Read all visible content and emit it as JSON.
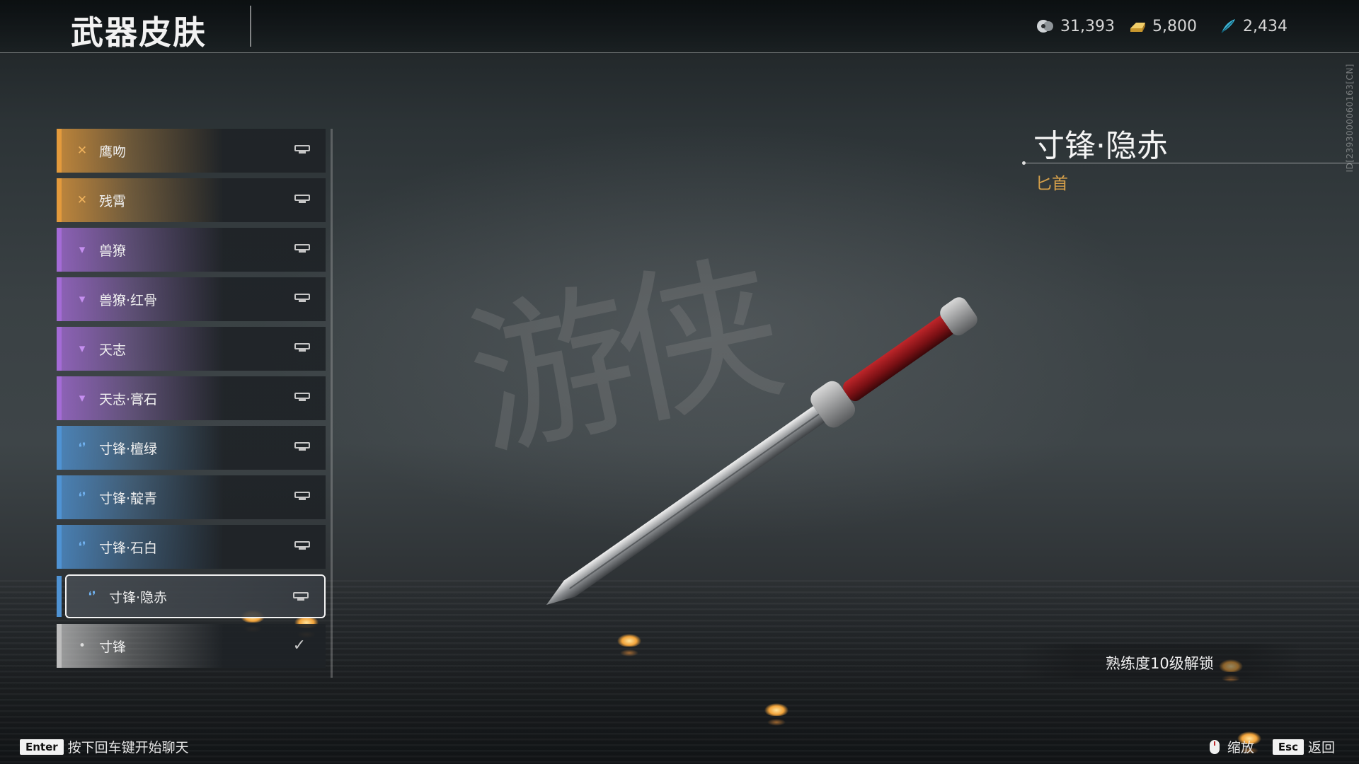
{
  "header": {
    "title": "武器皮肤",
    "currencies": [
      {
        "icon": "jade-coin-icon",
        "value": "31,393",
        "color": "#cfd3d6"
      },
      {
        "icon": "gold-ingot-icon",
        "value": "5,800",
        "color": "#e8c25a"
      },
      {
        "icon": "blue-feather-icon",
        "value": "2,434",
        "color": "#3fb6d6"
      }
    ],
    "build_id": "ID[2393000060163[CN]"
  },
  "skins": [
    {
      "label": "鹰吻",
      "rarity_color": "#e39a3c",
      "glyph": "✕",
      "glyph_color": "#f0b25c",
      "selected": false,
      "owned": false
    },
    {
      "label": "残霄",
      "rarity_color": "#e39a3c",
      "glyph": "✕",
      "glyph_color": "#f0b25c",
      "selected": false,
      "owned": false
    },
    {
      "label": "兽獠",
      "rarity_color": "#a46bd6",
      "glyph": "▾",
      "glyph_color": "#c58ef0",
      "selected": false,
      "owned": false
    },
    {
      "label": "兽獠·红骨",
      "rarity_color": "#a46bd6",
      "glyph": "▾",
      "glyph_color": "#c58ef0",
      "selected": false,
      "owned": false
    },
    {
      "label": "天志",
      "rarity_color": "#a46bd6",
      "glyph": "▾",
      "glyph_color": "#c58ef0",
      "selected": false,
      "owned": false
    },
    {
      "label": "天志·膏石",
      "rarity_color": "#a46bd6",
      "glyph": "▾",
      "glyph_color": "#c58ef0",
      "selected": false,
      "owned": false
    },
    {
      "label": "寸锋·檀绿",
      "rarity_color": "#4f93d4",
      "glyph": "❛❜",
      "glyph_color": "#6fb0ee",
      "selected": false,
      "owned": false
    },
    {
      "label": "寸锋·靛青",
      "rarity_color": "#4f93d4",
      "glyph": "❛❜",
      "glyph_color": "#6fb0ee",
      "selected": false,
      "owned": false
    },
    {
      "label": "寸锋·石白",
      "rarity_color": "#4f93d4",
      "glyph": "❛❜",
      "glyph_color": "#6fb0ee",
      "selected": false,
      "owned": false
    },
    {
      "label": "寸锋·隐赤",
      "rarity_color": "#4f93d4",
      "glyph": "❛❜",
      "glyph_color": "#6fb0ee",
      "selected": true,
      "owned": false
    },
    {
      "label": "寸锋",
      "rarity_color": "#bdbdbd",
      "glyph": "•",
      "glyph_color": "#dddddd",
      "selected": false,
      "owned": true
    }
  ],
  "detail": {
    "name": "寸锋·隐赤",
    "type": "匕首",
    "unlock": "熟练度10级解锁"
  },
  "footer": {
    "enter_key": "Enter",
    "enter_hint": "按下回车键开始聊天",
    "zoom_label": "缩放",
    "esc_key": "Esc",
    "back_label": "返回"
  }
}
